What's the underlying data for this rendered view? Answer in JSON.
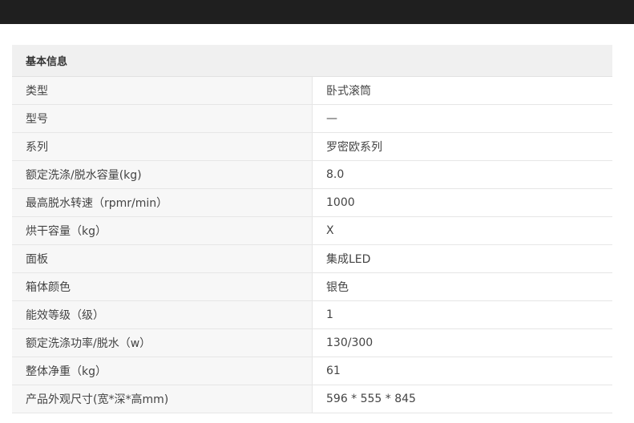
{
  "section": {
    "title": "基本信息"
  },
  "rows": [
    {
      "label": "类型",
      "value": "卧式滚筒"
    },
    {
      "label": "型号",
      "value": "—"
    },
    {
      "label": "系列",
      "value": "罗密欧系列"
    },
    {
      "label": "额定洗涤/脱水容量(kg)",
      "value": "8.0"
    },
    {
      "label": "最高脱水转速（rpmr/min）",
      "value": "1000"
    },
    {
      "label": "烘干容量（kg）",
      "value": "X"
    },
    {
      "label": "面板",
      "value": "集成LED"
    },
    {
      "label": "箱体颜色",
      "value": "银色"
    },
    {
      "label": "能效等级（级）",
      "value": "1"
    },
    {
      "label": "额定洗涤功率/脱水（w）",
      "value": "130/300"
    },
    {
      "label": "整体净重（kg）",
      "value": "61"
    },
    {
      "label": "产品外观尺寸(宽*深*高mm)",
      "value": "596 * 555 * 845"
    }
  ]
}
